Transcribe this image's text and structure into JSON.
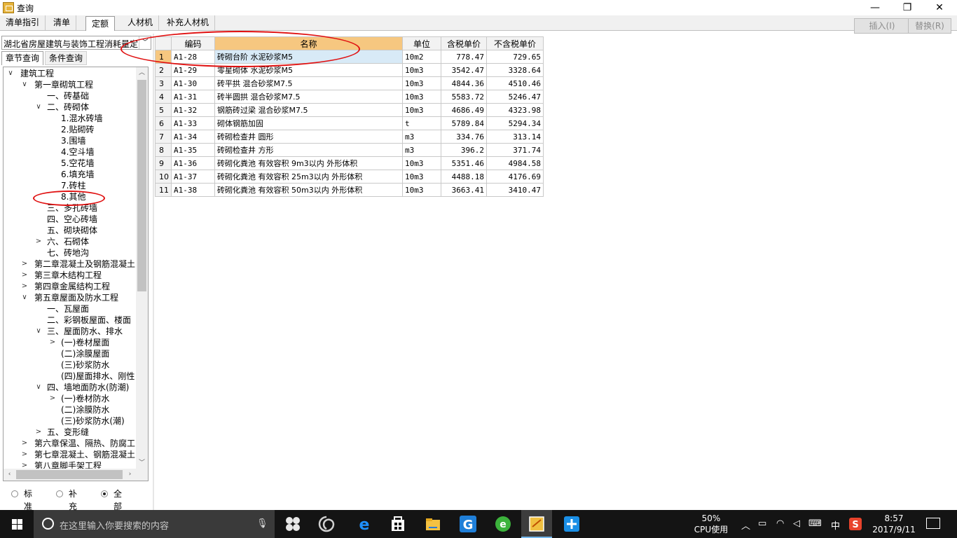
{
  "window": {
    "title": "查询"
  },
  "titlebar_buttons": {
    "min": "—",
    "max": "❐",
    "close": "✕"
  },
  "tabs": [
    "清单指引",
    "清单",
    "定额",
    "人材机",
    "补充人材机"
  ],
  "active_tab": "定额",
  "toolbar": {
    "insert_label": "插入(I)",
    "replace_label": "替换(R)"
  },
  "library": {
    "selected": "湖北省房屋建筑与装饰工程消耗量定额"
  },
  "subtabs": {
    "chapter": "章节查询",
    "condition": "条件查询"
  },
  "tree": [
    {
      "label": "建筑工程",
      "level": 0,
      "exp": "v"
    },
    {
      "label": "第一章砌筑工程",
      "level": 1,
      "exp": "v"
    },
    {
      "label": "一、砖基础",
      "level": 2,
      "exp": ""
    },
    {
      "label": "二、砖砌体",
      "level": 2,
      "exp": "v"
    },
    {
      "label": "1.混水砖墙",
      "level": 3,
      "exp": ""
    },
    {
      "label": "2.贴砌砖",
      "level": 3,
      "exp": ""
    },
    {
      "label": "3.围墙",
      "level": 3,
      "exp": ""
    },
    {
      "label": "4.空斗墙",
      "level": 3,
      "exp": ""
    },
    {
      "label": "5.空花墙",
      "level": 3,
      "exp": ""
    },
    {
      "label": "6.填充墙",
      "level": 3,
      "exp": ""
    },
    {
      "label": "7.砖柱",
      "level": 3,
      "exp": ""
    },
    {
      "label": "8.其他",
      "level": 3,
      "exp": ""
    },
    {
      "label": "三、多孔砖墙",
      "level": 2,
      "exp": ""
    },
    {
      "label": "四、空心砖墙",
      "level": 2,
      "exp": ""
    },
    {
      "label": "五、砌块砌体",
      "level": 2,
      "exp": ""
    },
    {
      "label": "六、石砌体",
      "level": 2,
      "exp": ">"
    },
    {
      "label": "七、砖地沟",
      "level": 2,
      "exp": ""
    },
    {
      "label": "第二章混凝土及钢筋混凝土",
      "level": 1,
      "exp": ">"
    },
    {
      "label": "第三章木结构工程",
      "level": 1,
      "exp": ">"
    },
    {
      "label": "第四章金属结构工程",
      "level": 1,
      "exp": ">"
    },
    {
      "label": "第五章屋面及防水工程",
      "level": 1,
      "exp": "v"
    },
    {
      "label": "一、瓦屋面",
      "level": 2,
      "exp": ""
    },
    {
      "label": "二、彩钢板屋面、楼面",
      "level": 2,
      "exp": ""
    },
    {
      "label": "三、屋面防水、排水",
      "level": 2,
      "exp": "v"
    },
    {
      "label": "(一)卷材屋面",
      "level": 3,
      "exp": ">"
    },
    {
      "label": "(二)涂膜屋面",
      "level": 3,
      "exp": ""
    },
    {
      "label": "(三)砂浆防水",
      "level": 3,
      "exp": ""
    },
    {
      "label": "(四)屋面排水、刚性",
      "level": 3,
      "exp": ""
    },
    {
      "label": "四、墙地面防水(防潮)",
      "level": 2,
      "exp": "v"
    },
    {
      "label": "(一)卷材防水",
      "level": 3,
      "exp": ">"
    },
    {
      "label": "(二)涂膜防水",
      "level": 3,
      "exp": ""
    },
    {
      "label": "(三)砂浆防水(潮)",
      "level": 3,
      "exp": ""
    },
    {
      "label": "五、变形缝",
      "level": 2,
      "exp": ">"
    },
    {
      "label": "第六章保温、隔热、防腐工",
      "level": 1,
      "exp": ">"
    },
    {
      "label": "第七章混凝土、钢筋混凝土",
      "level": 1,
      "exp": ">"
    },
    {
      "label": "第八章脚手架工程",
      "level": 1,
      "exp": ">"
    }
  ],
  "radios": {
    "standard": "标准",
    "supplement": "补充",
    "all": "全部",
    "selected": "全部"
  },
  "grid": {
    "headers": [
      "编码",
      "名称",
      "单位",
      "含税单价",
      "不含税单价"
    ],
    "rows": [
      {
        "no": "1",
        "code": "A1-28",
        "name": "砖砌台阶 水泥砂浆M5",
        "unit": "10m2",
        "tax": "778.47",
        "notax": "729.65"
      },
      {
        "no": "2",
        "code": "A1-29",
        "name": "零星砌体 水泥砂浆M5",
        "unit": "10m3",
        "tax": "3542.47",
        "notax": "3328.64"
      },
      {
        "no": "3",
        "code": "A1-30",
        "name": "砖平拱 混合砂浆M7.5",
        "unit": "10m3",
        "tax": "4844.36",
        "notax": "4510.46"
      },
      {
        "no": "4",
        "code": "A1-31",
        "name": "砖半圆拱 混合砂浆M7.5",
        "unit": "10m3",
        "tax": "5583.72",
        "notax": "5246.47"
      },
      {
        "no": "5",
        "code": "A1-32",
        "name": "钢筋砖过梁 混合砂浆M7.5",
        "unit": "10m3",
        "tax": "4686.49",
        "notax": "4323.98"
      },
      {
        "no": "6",
        "code": "A1-33",
        "name": "砌体钢筋加固",
        "unit": "t",
        "tax": "5789.84",
        "notax": "5294.34"
      },
      {
        "no": "7",
        "code": "A1-34",
        "name": "砖砌检查井 圆形",
        "unit": "m3",
        "tax": "334.76",
        "notax": "313.14"
      },
      {
        "no": "8",
        "code": "A1-35",
        "name": "砖砌检查井 方形",
        "unit": "m3",
        "tax": "396.2",
        "notax": "371.74"
      },
      {
        "no": "9",
        "code": "A1-36",
        "name": "砖砌化粪池 有效容积 9m3以内 外形体积",
        "unit": "10m3",
        "tax": "5351.46",
        "notax": "4984.58"
      },
      {
        "no": "10",
        "code": "A1-37",
        "name": "砖砌化粪池 有效容积 25m3以内 外形体积",
        "unit": "10m3",
        "tax": "4488.18",
        "notax": "4176.69"
      },
      {
        "no": "11",
        "code": "A1-38",
        "name": "砖砌化粪池 有效容积 50m3以内 外形体积",
        "unit": "10m3",
        "tax": "3663.41",
        "notax": "3410.47"
      }
    ]
  },
  "taskbar": {
    "search_placeholder": "在这里输入你要搜索的内容",
    "cpu_percent": "50%",
    "cpu_label": "CPU使用",
    "ime": "中",
    "time": "8:57",
    "date": "2017/9/11"
  },
  "colors": {
    "selected_header": "#f6c780",
    "selected_cell": "#d8eaf7",
    "annotation": "#e01010",
    "taskbar": "#141414"
  }
}
